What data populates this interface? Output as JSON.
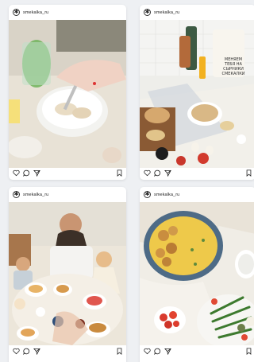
{
  "posts": [
    {
      "username": "smekalka_ru",
      "image_alt": "dinner plate with chicken and fork, glass of green drink"
    },
    {
      "username": "smekalka_ru",
      "image_alt": "picnic spread with bread, eggs, juice and sign"
    },
    {
      "username": "smekalka_ru",
      "image_alt": "family at table with pancakes and breakfast"
    },
    {
      "username": "smekalka_ru",
      "image_alt": "potatoes with scrambled eggs, green beans and tomatoes"
    }
  ],
  "sign_text": [
    "МЕНЯЕМ",
    "ТЕБЯ НА",
    "СЫРНИКИ",
    "СМЕКАЛКИ"
  ],
  "icons": {
    "avatar": "smekalka-logo-icon",
    "like": "heart-icon",
    "comment": "comment-icon",
    "share": "send-icon",
    "save": "bookmark-icon"
  }
}
